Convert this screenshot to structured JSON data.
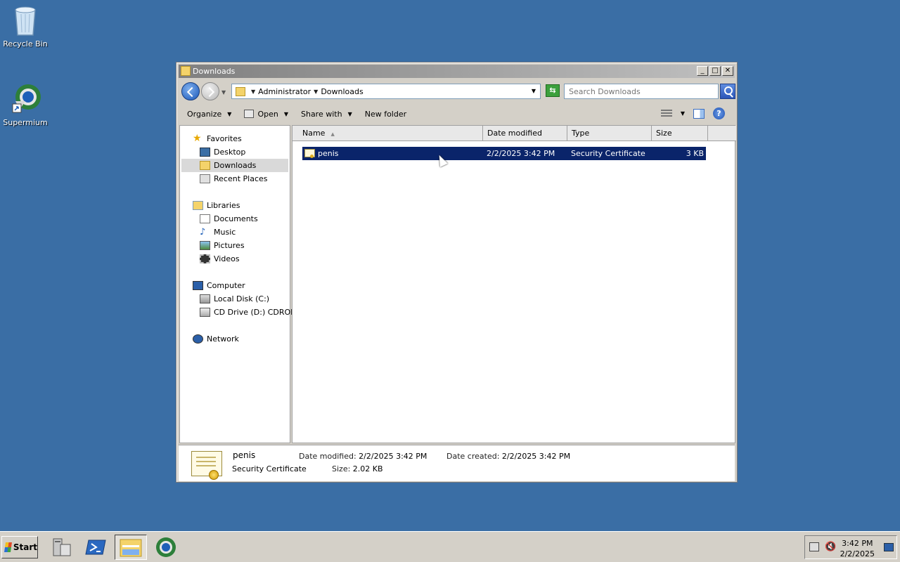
{
  "desktop": {
    "icons": [
      {
        "label": "Recycle Bin",
        "icon": "recycle-bin-icon"
      },
      {
        "label": "Supermium",
        "icon": "supermium-browser-icon"
      }
    ]
  },
  "window": {
    "title": "Downloads",
    "breadcrumb": [
      "Administrator",
      "Downloads"
    ],
    "search_placeholder": "Search Downloads",
    "toolbar": {
      "organize": "Organize",
      "open": "Open",
      "share_with": "Share with",
      "new_folder": "New folder"
    },
    "nav": {
      "favorites": "Favorites",
      "desktop": "Desktop",
      "downloads": "Downloads",
      "recent_places": "Recent Places",
      "libraries": "Libraries",
      "documents": "Documents",
      "music": "Music",
      "pictures": "Pictures",
      "videos": "Videos",
      "computer": "Computer",
      "local_disk": "Local Disk (C:)",
      "cd_drive": "CD Drive (D:) CDROM",
      "network": "Network"
    },
    "columns": {
      "name": "Name",
      "date_modified": "Date modified",
      "type": "Type",
      "size": "Size"
    },
    "files": [
      {
        "name": "penis",
        "date_modified": "2/2/2025 3:42 PM",
        "type": "Security Certificate",
        "size": "3 KB",
        "selected": true
      }
    ],
    "details": {
      "name": "penis",
      "type": "Security Certificate",
      "date_modified_label": "Date modified:",
      "date_modified": "2/2/2025 3:42 PM",
      "size_label": "Size:",
      "size": "2.02 KB",
      "date_created_label": "Date created:",
      "date_created": "2/2/2025 3:42 PM"
    }
  },
  "taskbar": {
    "start_label": "Start",
    "apps": [
      "server-manager-icon",
      "powershell-icon",
      "windows-explorer-icon",
      "supermium-browser-icon"
    ],
    "clock_time": "3:42 PM",
    "clock_date": "2/2/2025"
  },
  "colors": {
    "desktop": "#3a6ea5",
    "selection": "#0a246a",
    "window_chrome": "#d4d0c8"
  }
}
